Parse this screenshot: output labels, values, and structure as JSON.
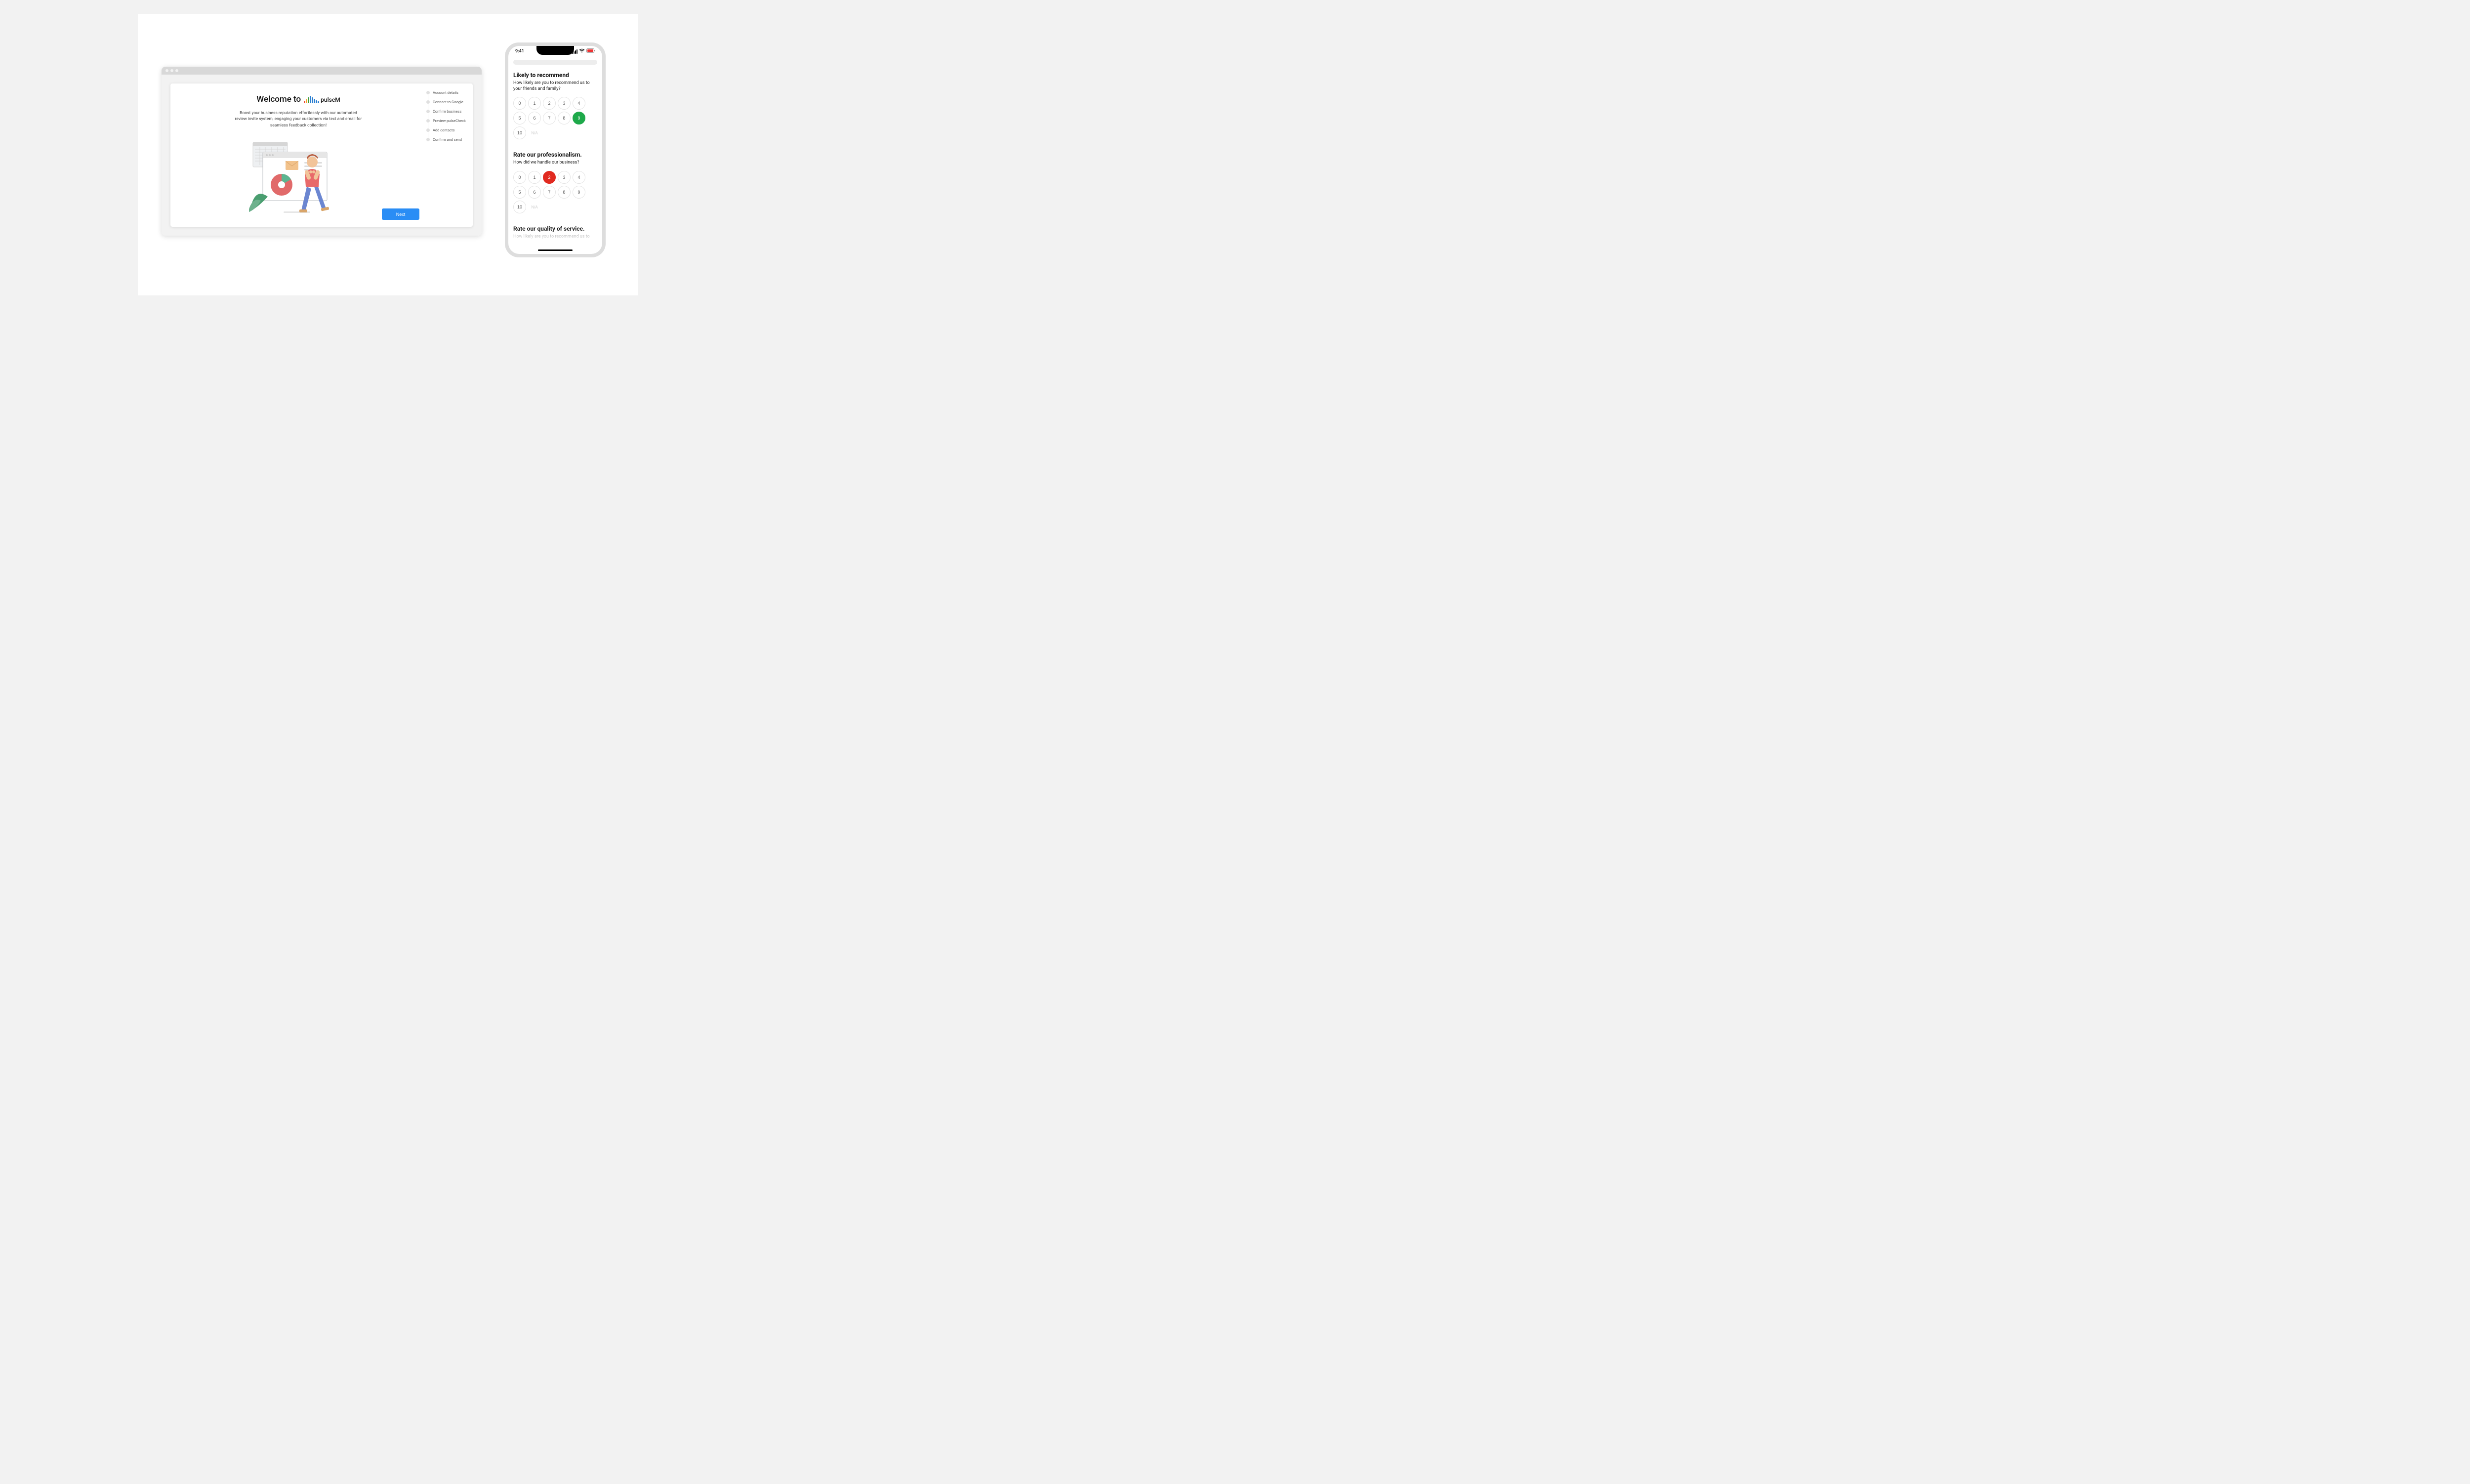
{
  "desktop": {
    "welcome_prefix": "Welcome to",
    "logo_text": "pulseM",
    "subheading": "Boost your business reputation effortlessly with our automated review invite system, engaging your customers via text and email for seamless feedback collection!",
    "next_button": "Next",
    "steps": [
      "Account details",
      "Connect to Google",
      "Confirm business",
      "Preview pulseCheck",
      "Add contacts",
      "Confirm and send"
    ]
  },
  "phone": {
    "status_time": "9:41",
    "questions": [
      {
        "title": "Likely to recommend",
        "sub": "How likely are you to recommend us to your friends and family?",
        "options": [
          "0",
          "1",
          "2",
          "3",
          "4",
          "5",
          "6",
          "7",
          "8",
          "9",
          "10",
          "N/A"
        ],
        "selected": "9",
        "selected_color": "green"
      },
      {
        "title": "Rate our professionalism.",
        "sub": "How did we handle our business?",
        "options": [
          "0",
          "1",
          "2",
          "3",
          "4",
          "5",
          "6",
          "7",
          "8",
          "9",
          "10",
          "N/A"
        ],
        "selected": "2",
        "selected_color": "red"
      },
      {
        "title": "Rate our quality of service.",
        "sub": "How likely are you to recommend us to your"
      }
    ]
  }
}
